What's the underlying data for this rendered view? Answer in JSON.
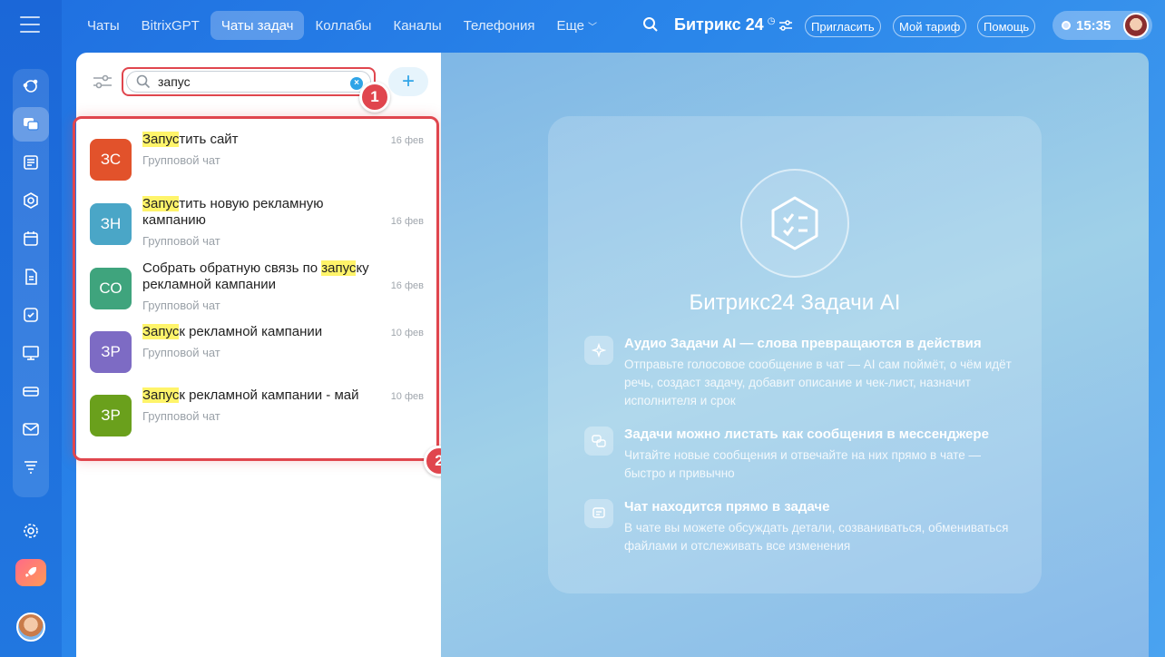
{
  "topnav": {
    "tabs": [
      "Чаты",
      "BitrixGPT",
      "Чаты задач",
      "Коллабы",
      "Каналы",
      "Телефония",
      "Еще"
    ],
    "brand": "Битрикс 24",
    "invite": "Пригласить",
    "tariff": "Мой тариф",
    "help": "Помощь",
    "time": "15:35"
  },
  "search": {
    "value": "запус"
  },
  "badges": {
    "one": "1",
    "two": "2"
  },
  "results": [
    {
      "initials": "ЗС",
      "color": "#e2522b",
      "hl": "Запус",
      "rest1": "тить сайт",
      "pre": "",
      "sub": "Групповой чат",
      "date": "16 фев"
    },
    {
      "initials": "ЗН",
      "color": "#4aa6c7",
      "hl": "Запус",
      "rest1": "тить новую рекламную кампанию",
      "pre": "",
      "sub": "Групповой чат",
      "date": "16 фев"
    },
    {
      "initials": "СО",
      "color": "#3fa47d",
      "hl": "запус",
      "rest1": "ку рекламной кампании",
      "pre": "Собрать обратную связь по ",
      "sub": "Групповой чат",
      "date": "16 фев"
    },
    {
      "initials": "ЗР",
      "color": "#7d6bc4",
      "hl": "Запус",
      "rest1": "к рекламной кампании",
      "pre": "",
      "sub": "Групповой чат",
      "date": "10 фев"
    },
    {
      "initials": "ЗР",
      "color": "#6aa01c",
      "hl": "Запус",
      "rest1": "к рекламной кампании - май",
      "pre": "",
      "sub": "Групповой чат",
      "date": "10 фев"
    }
  ],
  "promo": {
    "title": "Битрикс24 Задачи AI",
    "features": [
      {
        "title": "Аудио Задачи AI — слова превращаются в действия",
        "text": "Отправьте голосовое сообщение в чат — AI сам поймёт, о чём идёт речь, создаст задачу, добавит описание и чек-лист, назначит исполнителя и срок",
        "icon": "sparkle-icon"
      },
      {
        "title": "Задачи можно листать как сообщения в мессенджере",
        "text": "Читайте новые сообщения и отвечайте на них прямо в чате — быстро и привычно",
        "icon": "chat-bubbles-icon"
      },
      {
        "title": "Чат находится прямо в задаче",
        "text": "В чате вы можете обсуждать детали, созваниваться, обмениваться файлами и отслеживать все изменения",
        "icon": "message-icon"
      }
    ]
  }
}
